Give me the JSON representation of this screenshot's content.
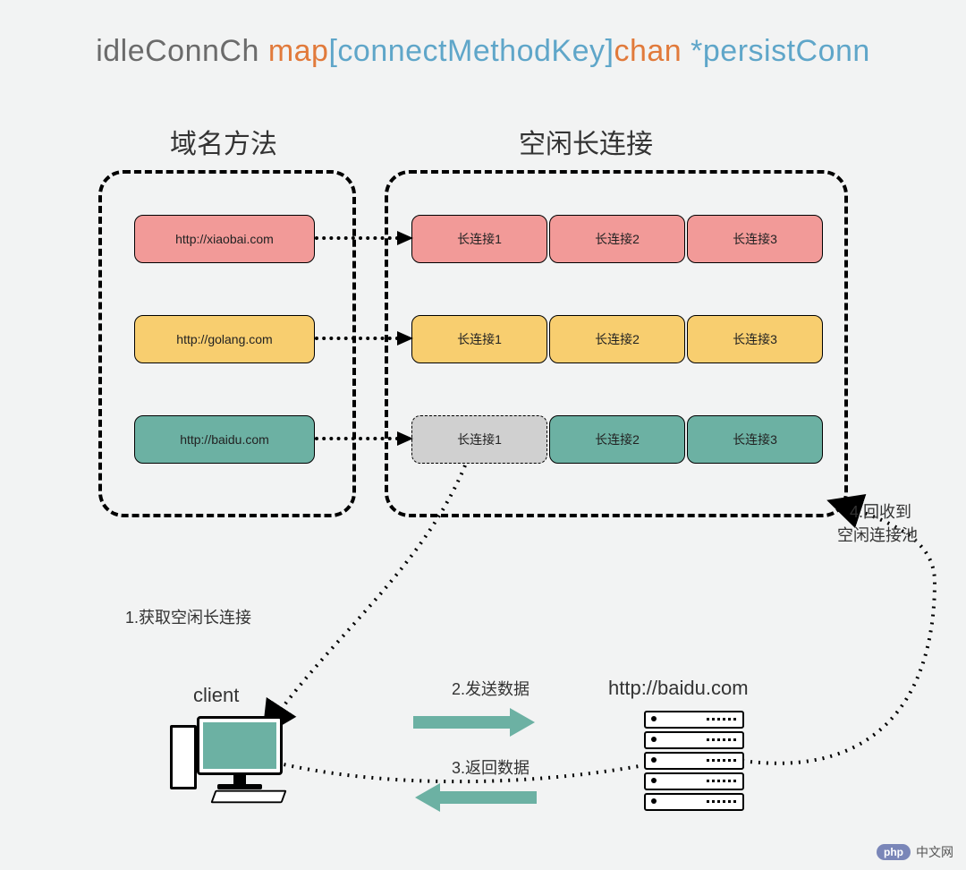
{
  "title": {
    "p1": "idleConnCh ",
    "p2": "map",
    "p3": "[",
    "p4": "connectMethodKey",
    "p5": "]",
    "p6": "chan ",
    "p7": "*persistConn"
  },
  "sections": {
    "left": "域名方法",
    "right": "空闲长连接"
  },
  "keys": [
    {
      "label": "http://xiaobai.com",
      "cls": "red"
    },
    {
      "label": "http://golang.com",
      "cls": "yellow"
    },
    {
      "label": "http://baidu.com",
      "cls": "teal"
    }
  ],
  "rows": [
    {
      "cls": "red",
      "cells": [
        "长连接1",
        "长连接2",
        "长连接3"
      ],
      "dashedFirst": false
    },
    {
      "cls": "yellow",
      "cells": [
        "长连接1",
        "长连接2",
        "长连接3"
      ],
      "dashedFirst": false
    },
    {
      "cls": "teal",
      "cells": [
        "长连接1",
        "长连接2",
        "长连接3"
      ],
      "dashedFirst": true
    }
  ],
  "steps": {
    "s1": "1.获取空闲长连接",
    "s2": "2.发送数据",
    "s3": "3.返回数据",
    "s4a": "4.回收到",
    "s4b": "空闲连接池"
  },
  "labels": {
    "client": "client",
    "server": "http://baidu.com"
  },
  "watermark": {
    "badge": "php",
    "text": "中文网"
  }
}
